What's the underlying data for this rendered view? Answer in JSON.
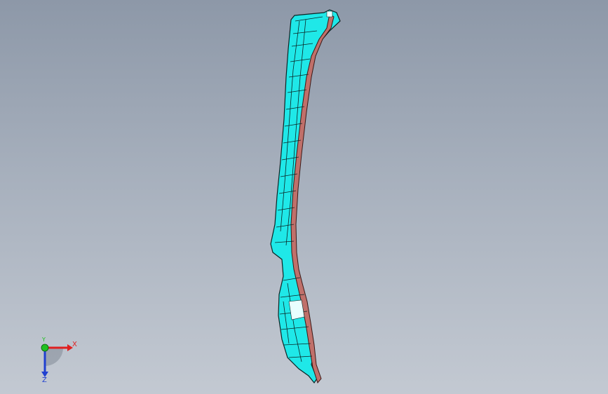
{
  "viewport": {
    "background_top": "#8d98a8",
    "background_bottom": "#c3c9d2"
  },
  "model": {
    "part_color": "#1fe8e8",
    "edge_color": "#1a2a2a",
    "flange_color": "#c0706a"
  },
  "triad": {
    "x_label": "X",
    "y_label": "Y",
    "z_label": "Z",
    "x_color": "#e02020",
    "y_color": "#20c020",
    "z_color": "#2040d0"
  }
}
